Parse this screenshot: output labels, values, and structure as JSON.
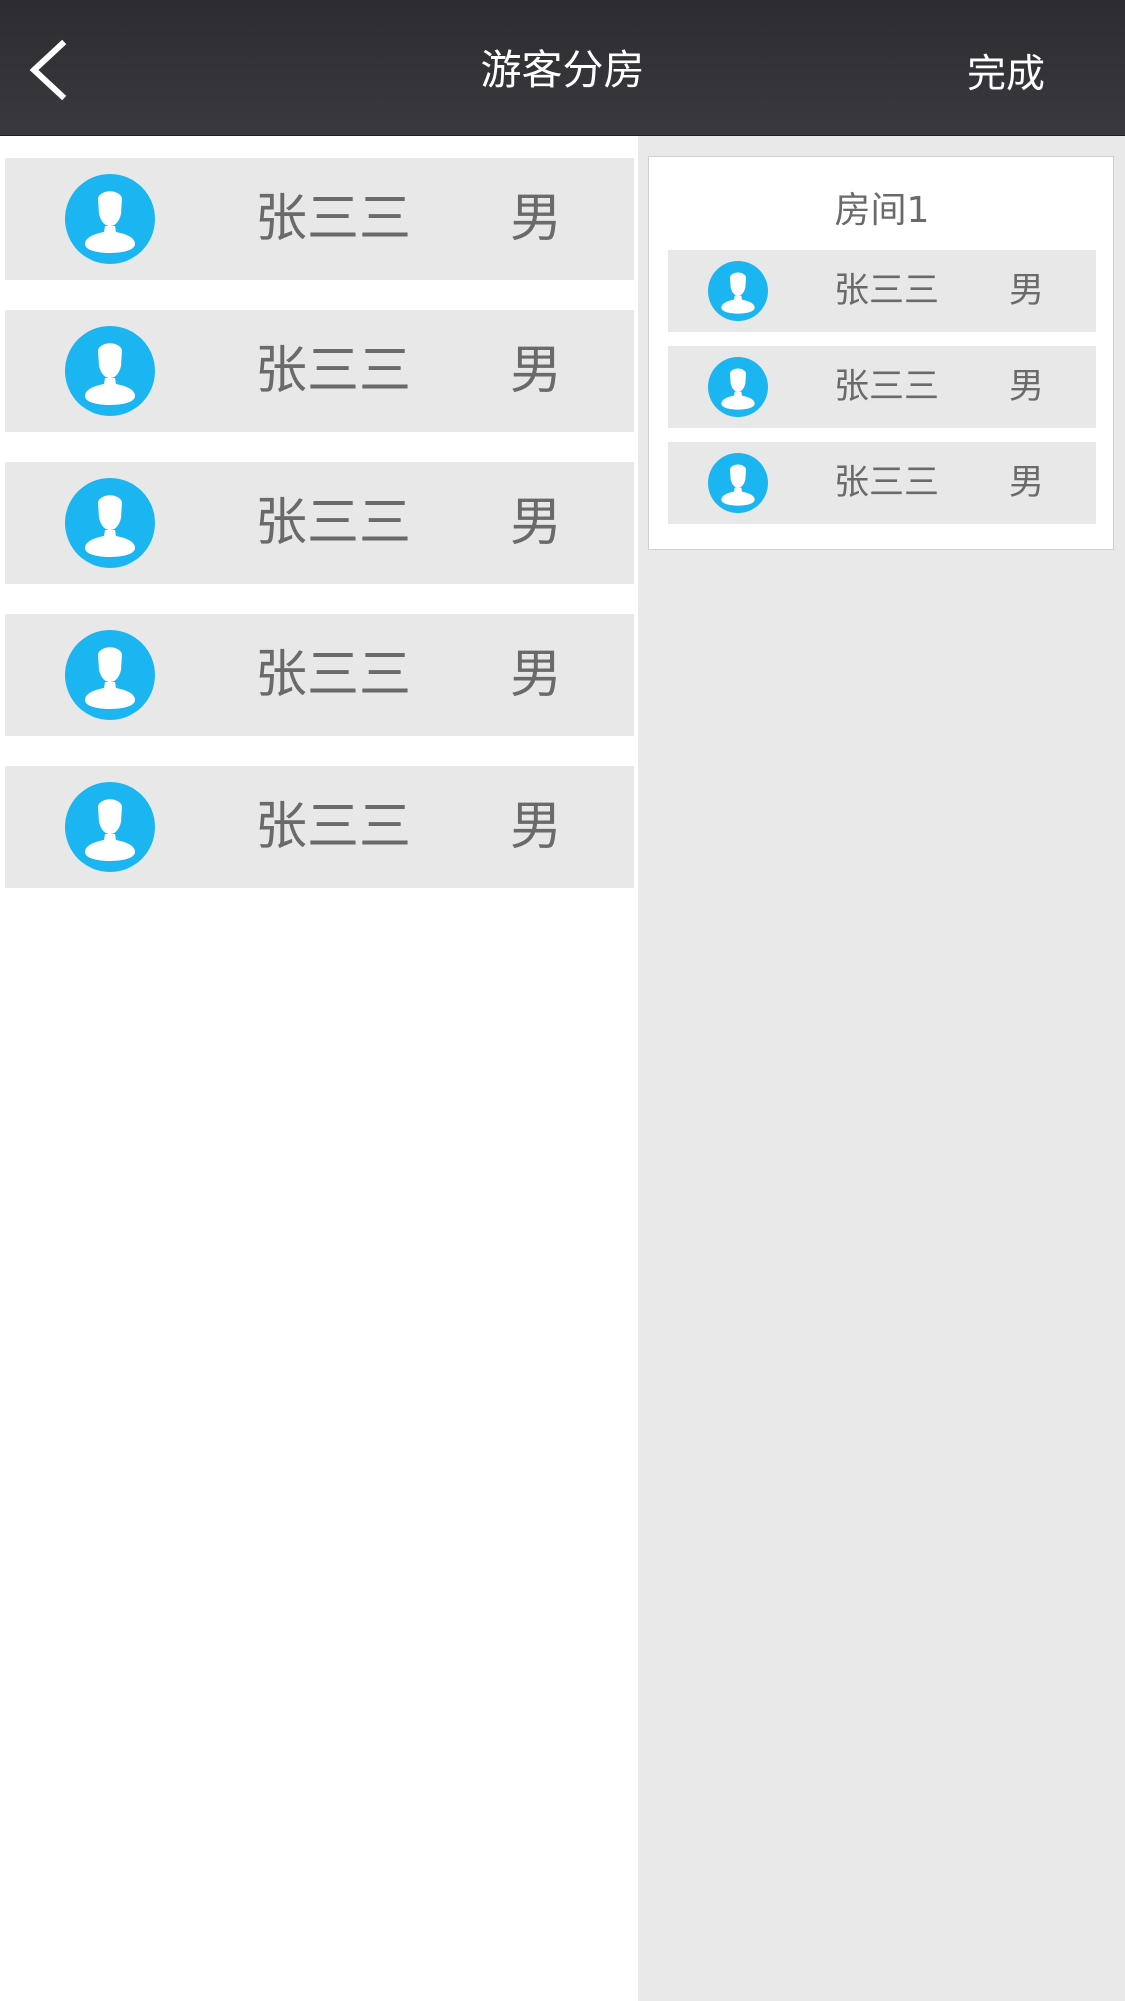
{
  "header": {
    "title": "游客分房",
    "done_label": "完成",
    "back_icon": "chevron-left-icon"
  },
  "guests": [
    {
      "name": "张三三",
      "gender": "男",
      "avatar_icon": "user-avatar-icon"
    },
    {
      "name": "张三三",
      "gender": "男",
      "avatar_icon": "user-avatar-icon"
    },
    {
      "name": "张三三",
      "gender": "男",
      "avatar_icon": "user-avatar-icon"
    },
    {
      "name": "张三三",
      "gender": "男",
      "avatar_icon": "user-avatar-icon"
    },
    {
      "name": "张三三",
      "gender": "男",
      "avatar_icon": "user-avatar-icon"
    }
  ],
  "room": {
    "title": "房间1",
    "members": [
      {
        "name": "张三三",
        "gender": "男",
        "avatar_icon": "user-avatar-icon"
      },
      {
        "name": "张三三",
        "gender": "男",
        "avatar_icon": "user-avatar-icon"
      },
      {
        "name": "张三三",
        "gender": "男",
        "avatar_icon": "user-avatar-icon"
      }
    ]
  },
  "colors": {
    "header_bg": "#333237",
    "avatar_blue": "#1bb6f2",
    "row_bg": "#e8e8e8",
    "text_gray": "#6a6a6a",
    "right_pane_bg": "#e9e9e9"
  }
}
